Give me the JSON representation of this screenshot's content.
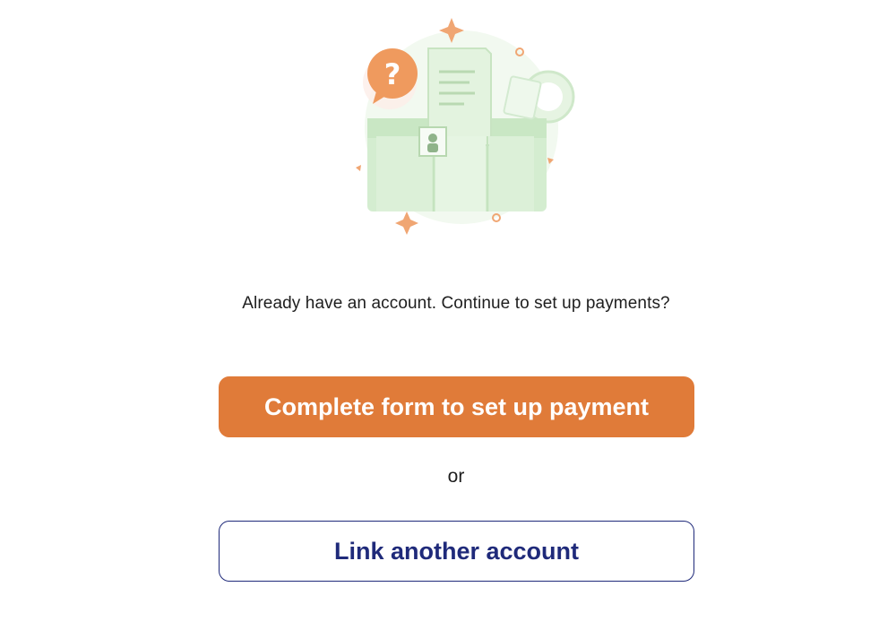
{
  "illustration": {
    "icon": "payment-form-illustration",
    "badge_symbol": "?"
  },
  "prompt_text": "Already have an account. Continue to set up payments?",
  "primary_button_label": "Complete form to set up payment",
  "separator_text": "or",
  "secondary_button_label": "Link another account",
  "colors": {
    "accent_orange": "#e07b39",
    "navy": "#1f2a7a",
    "illustration_green": "#d8efd4"
  }
}
